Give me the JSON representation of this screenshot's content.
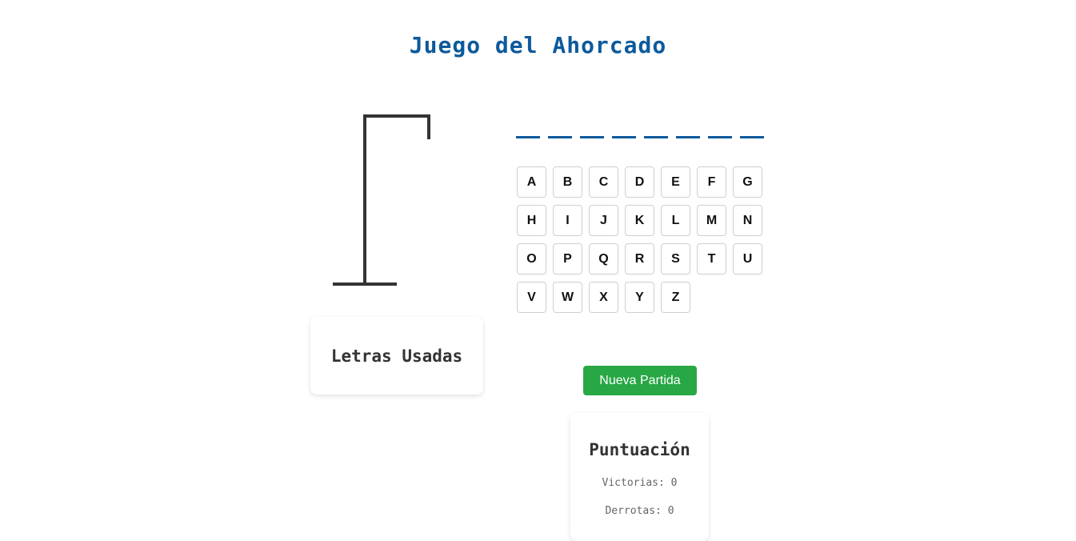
{
  "game": {
    "title": "Juego del Ahorcado"
  },
  "word": {
    "slots": [
      "",
      "",
      "",
      "",
      "",
      "",
      "",
      ""
    ]
  },
  "keyboard": {
    "letters": [
      "A",
      "B",
      "C",
      "D",
      "E",
      "F",
      "G",
      "H",
      "I",
      "J",
      "K",
      "L",
      "M",
      "N",
      "O",
      "P",
      "Q",
      "R",
      "S",
      "T",
      "U",
      "V",
      "W",
      "X",
      "Y",
      "Z"
    ]
  },
  "used_letters": {
    "title": "Letras Usadas",
    "letters": ""
  },
  "actions": {
    "new_game_label": "Nueva Partida"
  },
  "score": {
    "title": "Puntuación",
    "wins_label": "Victorias:",
    "wins": "0",
    "losses_label": "Derrotas:",
    "losses": "0"
  },
  "colors": {
    "title": "#0c5a9c",
    "button": "#28a745",
    "gallows": "#333333"
  },
  "hangman": {
    "wrong_guesses": 0
  }
}
